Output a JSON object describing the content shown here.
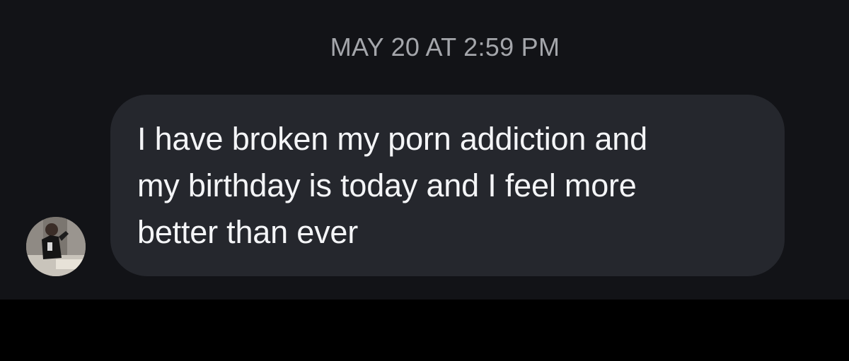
{
  "conversation": {
    "timestamp": "MAY 20 AT 2:59 PM",
    "messages": [
      {
        "sender": "other",
        "avatar_icon": "profile-photo",
        "lines": [
          "I have broken my porn addiction and",
          "my birthday is today and I feel more",
          "better than ever"
        ]
      }
    ]
  },
  "colors": {
    "chat_background": "#121317",
    "bubble_background": "#25272d",
    "message_text": "#f4f5f7",
    "timestamp_text": "#a4a6ab",
    "bottom_bar": "#000000"
  }
}
